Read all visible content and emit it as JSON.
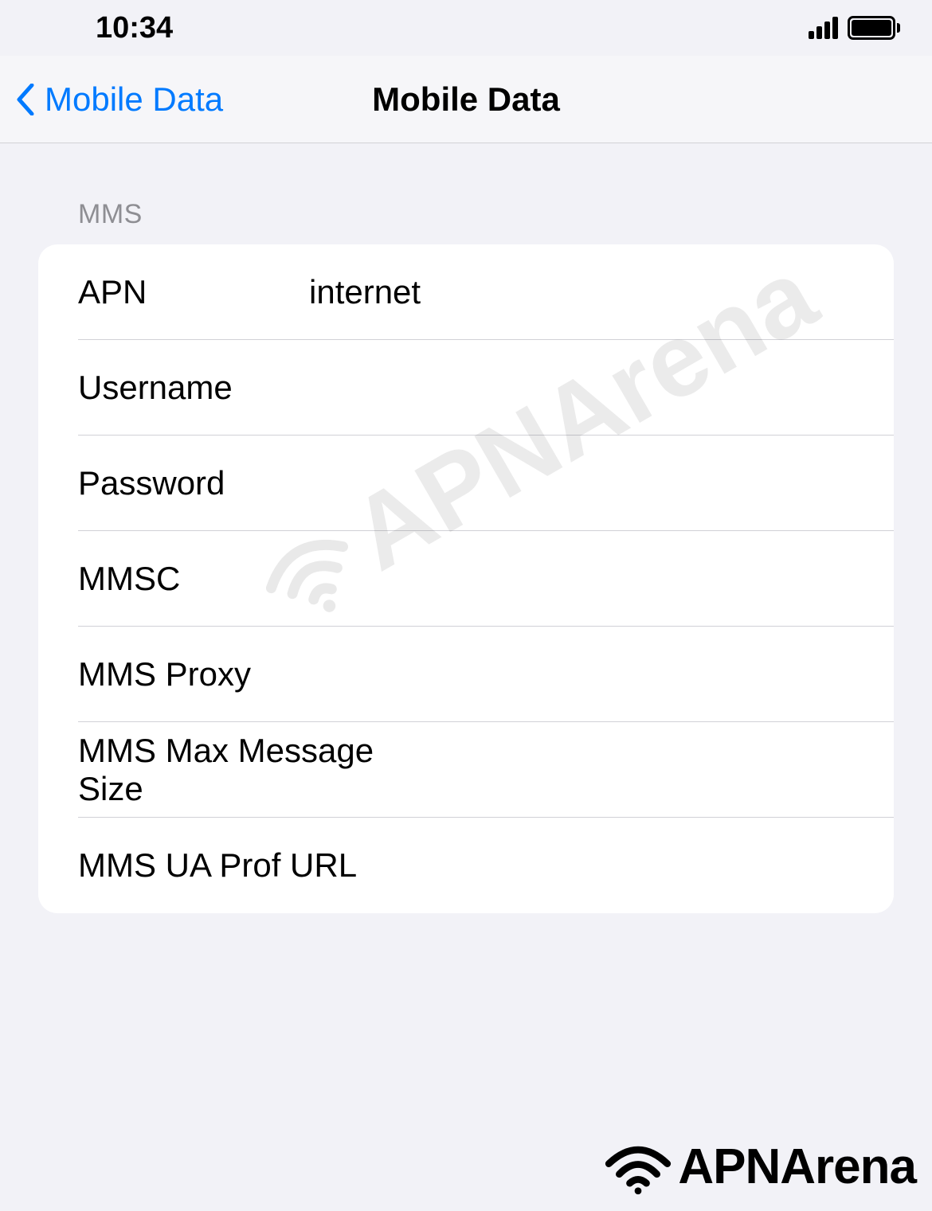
{
  "status_bar": {
    "time": "10:34"
  },
  "nav": {
    "back_label": "Mobile Data",
    "title": "Mobile Data"
  },
  "section": {
    "header": "MMS",
    "rows": [
      {
        "label": "APN",
        "value": "internet"
      },
      {
        "label": "Username",
        "value": ""
      },
      {
        "label": "Password",
        "value": ""
      },
      {
        "label": "MMSC",
        "value": ""
      },
      {
        "label": "MMS Proxy",
        "value": ""
      },
      {
        "label": "MMS Max Message Size",
        "value": ""
      },
      {
        "label": "MMS UA Prof URL",
        "value": ""
      }
    ]
  },
  "watermark": {
    "text": "APNArena"
  },
  "footer": {
    "text": "APNArena"
  }
}
